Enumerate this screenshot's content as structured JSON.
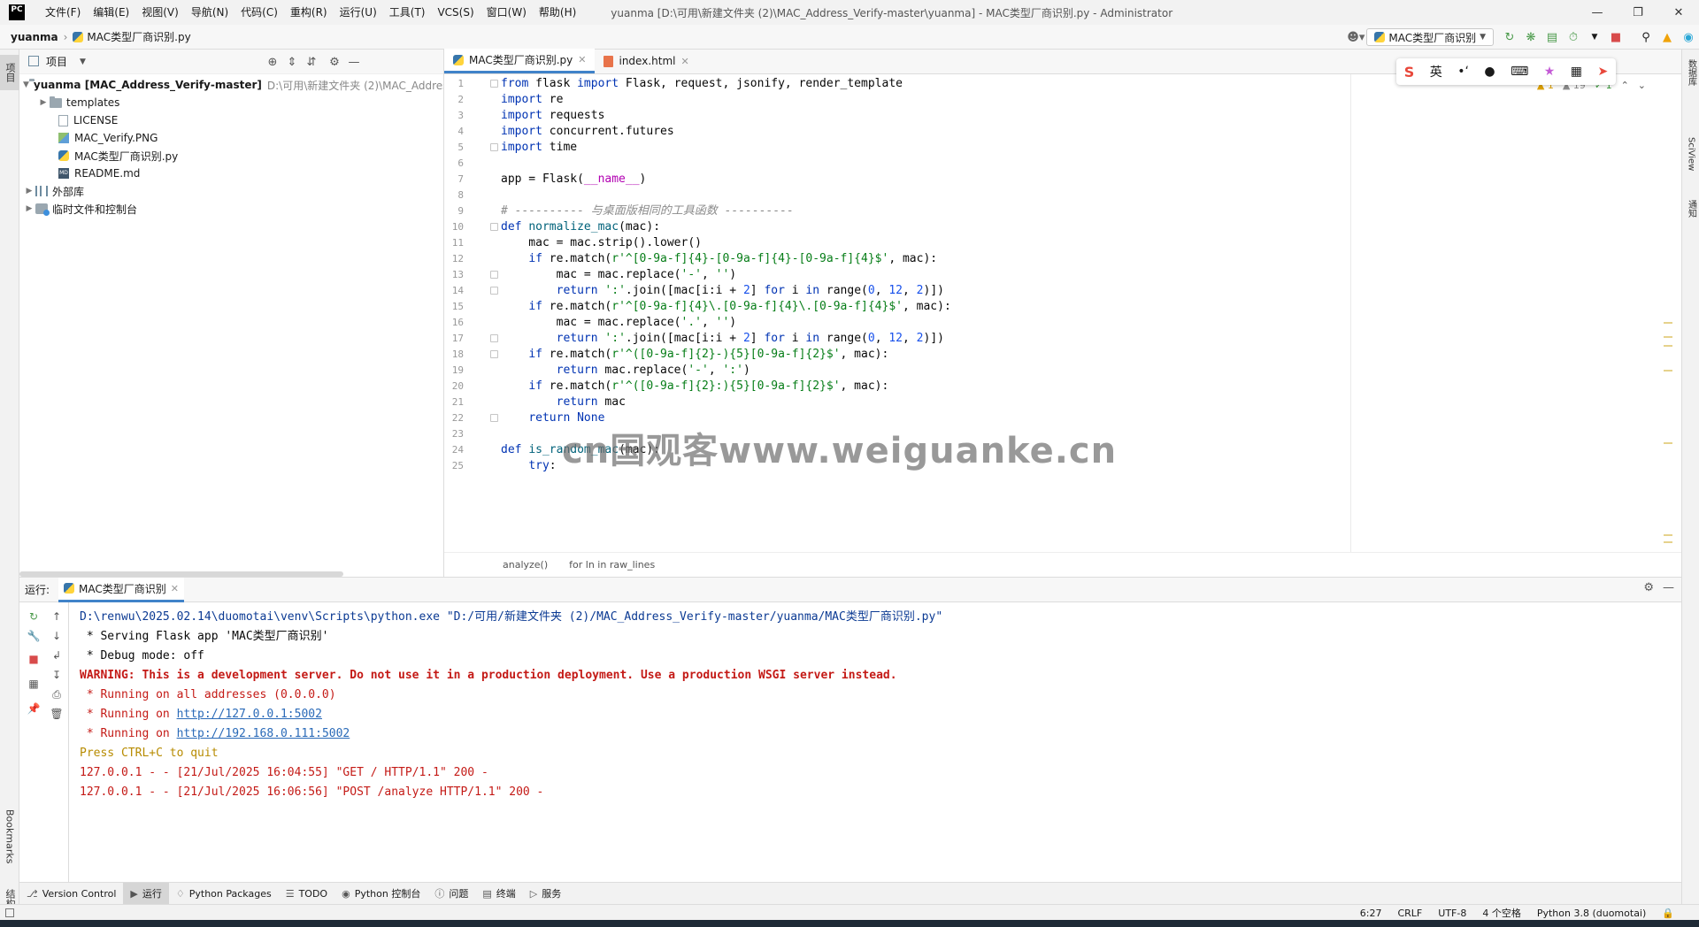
{
  "menubar": {
    "logo": "PC",
    "items": [
      "文件(F)",
      "编辑(E)",
      "视图(V)",
      "导航(N)",
      "代码(C)",
      "重构(R)",
      "运行(U)",
      "工具(T)",
      "VCS(S)",
      "窗口(W)",
      "帮助(H)"
    ],
    "window_title": "yuanma [D:\\可用\\新建文件夹 (2)\\MAC_Address_Verify-master\\yuanma] - MAC类型厂商识别.py - Administrator"
  },
  "navbar": {
    "project": "yuanma",
    "file": "MAC类型厂商识别.py",
    "run_config": "MAC类型厂商识别"
  },
  "left_strip": {
    "project_tab": "项目",
    "bookmarks_tab": "Bookmarks",
    "structure_tab": "结构"
  },
  "right_strip": {
    "tabs": [
      "数据库",
      "SciView",
      "通知"
    ]
  },
  "project_panel": {
    "title": "项目",
    "root_name": "yuanma [MAC_Address_Verify-master]",
    "root_path": "D:\\可用\\新建文件夹 (2)\\MAC_Address_Verify-master\\yuanma",
    "items": [
      "templates",
      "LICENSE",
      "MAC_Verify.PNG",
      "MAC类型厂商识别.py",
      "README.md"
    ],
    "external_libs": "外部库",
    "scratches": "临时文件和控制台"
  },
  "editor": {
    "tabs": [
      "MAC类型厂商识别.py",
      "index.html"
    ],
    "inspection": {
      "warnings": "1",
      "weak": "19",
      "ok": "1"
    },
    "line_numbers": [
      "1",
      "2",
      "3",
      "4",
      "5",
      "6",
      "7",
      "8",
      "9",
      "10",
      "11",
      "12",
      "13",
      "14",
      "15",
      "16",
      "17",
      "18",
      "19",
      "20",
      "21",
      "22",
      "23",
      "24",
      "25"
    ],
    "breadcrumb": [
      "analyze()",
      "for ln in raw_lines"
    ],
    "watermark": "cn国观客www.weiguanke.cn"
  },
  "ime": {
    "logo": "S",
    "lang": "英"
  },
  "run_panel": {
    "label": "运行:",
    "tab": "MAC类型厂商识别",
    "console": {
      "cmd": "D:\\renwu\\2025.02.14\\duomotai\\venv\\Scripts\\python.exe \"D:/可用/新建文件夹 (2)/MAC_Address_Verify-master/yuanma/MAC类型厂商识别.py\"",
      "serving": " * Serving Flask app 'MAC类型厂商识别'",
      "debug": " * Debug mode: off",
      "warning": "WARNING: This is a development server. Do not use it in a production deployment. Use a production WSGI server instead.",
      "running_all": " * Running on all addresses (0.0.0.0)",
      "running_on_prefix": " * Running on ",
      "url_local": "http://127.0.0.1:5002",
      "url_lan": "http://192.168.0.111:5002",
      "quit": "Press CTRL+C to quit",
      "log1": "127.0.0.1 - - [21/Jul/2025 16:04:55] \"GET / HTTP/1.1\" 200 -",
      "log2": "127.0.0.1 - - [21/Jul/2025 16:06:56] \"POST /analyze HTTP/1.1\" 200 -"
    }
  },
  "bottom_bar": {
    "items": [
      "Version Control",
      "运行",
      "Python Packages",
      "TODO",
      "Python 控制台",
      "问题",
      "终端",
      "服务"
    ]
  },
  "status_bar": {
    "position": "6:27",
    "line_sep": "CRLF",
    "encoding": "UTF-8",
    "indent": "4 个空格",
    "interpreter": "Python 3.8 (duomotai)"
  }
}
